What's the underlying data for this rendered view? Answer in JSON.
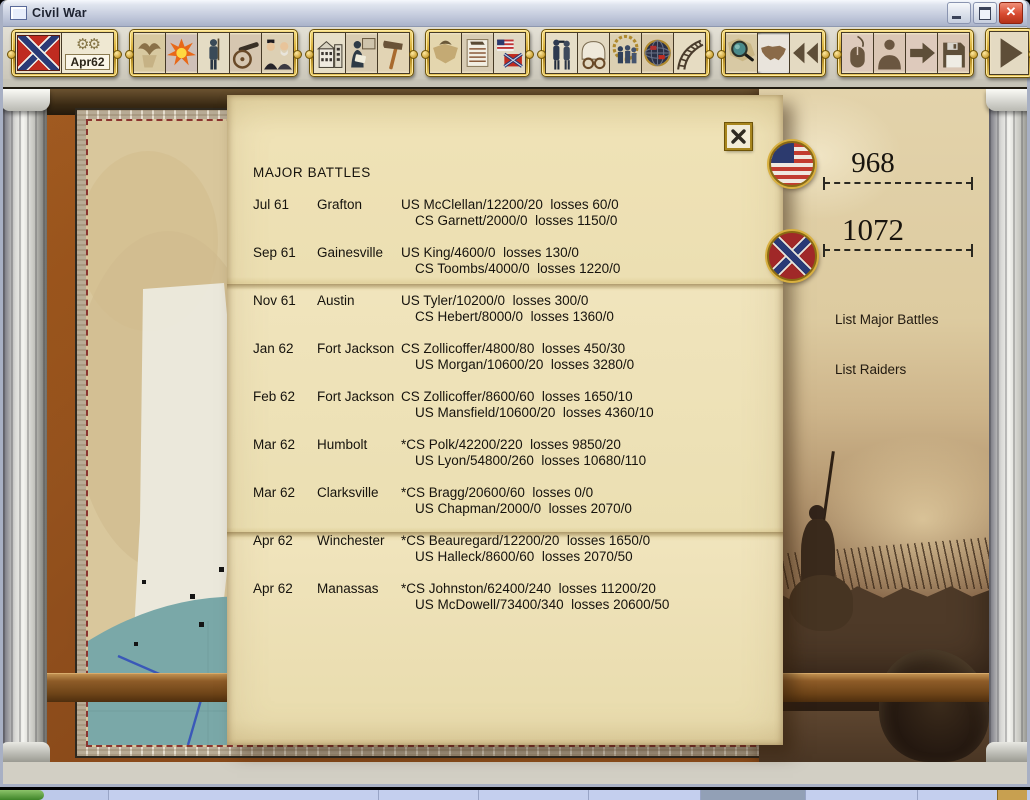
{
  "window": {
    "title": "Civil War",
    "control_icons": [
      "minimize-icon",
      "maximize-icon",
      "close-icon"
    ]
  },
  "toolbar": {
    "turn_label": "Apr62",
    "groups": [
      [
        "confederate-flag",
        "turn-gears"
      ],
      [
        "map-eagle",
        "battle-explosion",
        "infantry-soldier",
        "artillery-cannon",
        "generals-portraits"
      ],
      [
        "city-buildings",
        "dispatch-clerk",
        "production-hammer"
      ],
      [
        "political-map",
        "newspaper",
        "war-flags"
      ],
      [
        "scout-officers",
        "supply-wagon",
        "cavalry-troop",
        "world-globe",
        "railroad"
      ],
      [
        "map-magnifier",
        "us-map",
        "rewind"
      ],
      [
        "mouse-control",
        "commander-figure",
        "forward-arrow",
        "save-disk"
      ],
      [
        "play-advance"
      ]
    ]
  },
  "battle_list": {
    "title": "MAJOR BATTLES",
    "close_icon": "x-icon",
    "battles": [
      {
        "date": "Jul 61",
        "location": "Grafton",
        "side_a": "US McClellan/12200/20  losses 60/0",
        "side_b": "CS Garnett/2000/0  losses 1150/0"
      },
      {
        "date": "Sep 61",
        "location": "Gainesville",
        "side_a": "US King/4600/0  losses 130/0",
        "side_b": "CS Toombs/4000/0  losses 1220/0"
      },
      {
        "date": "Nov 61",
        "location": "Austin",
        "side_a": "US Tyler/10200/0  losses 300/0",
        "side_b": "CS Hebert/8000/0  losses 1360/0"
      },
      {
        "date": "Jan 62",
        "location": "Fort Jackson",
        "side_a": "CS Zollicoffer/4800/80  losses 450/30",
        "side_b": "US Morgan/10600/20  losses 3280/0"
      },
      {
        "date": "Feb 62",
        "location": "Fort Jackson",
        "side_a": "CS Zollicoffer/8600/60  losses 1650/10",
        "side_b": "US Mansfield/10600/20  losses 4360/10"
      },
      {
        "date": "Mar 62",
        "location": "Humbolt",
        "side_a": "*CS Polk/42200/220  losses 9850/20",
        "side_b": "US Lyon/54800/260  losses 10680/110"
      },
      {
        "date": "Mar 62",
        "location": "Clarksville",
        "side_a": "*CS Bragg/20600/60  losses 0/0",
        "side_b": "US Chapman/2000/0  losses 2070/0"
      },
      {
        "date": "Apr 62",
        "location": "Winchester",
        "side_a": "*CS Beauregard/12200/20  losses 1650/0",
        "side_b": "US Halleck/8600/60  losses 2070/50"
      },
      {
        "date": "Apr 62",
        "location": "Manassas",
        "side_a": "*CS Johnston/62400/240  losses 11200/20",
        "side_b": "US McDowell/73400/340  losses 20600/50"
      }
    ]
  },
  "side_panel": {
    "us_flag_icon": "union-flag-icon",
    "cs_flag_icon": "confederate-flag-icon",
    "us_strength": "968",
    "cs_strength": "1072",
    "links": [
      "List Major Battles",
      "List Raiders"
    ]
  },
  "colors": {
    "gold_frame": "#c9a227",
    "paper": "#ecdfb2",
    "parchment_map": "#d9c79c",
    "sea": "#7aa8a8",
    "rust_background": "#8a4a1a",
    "close_button": "#d84a30"
  }
}
